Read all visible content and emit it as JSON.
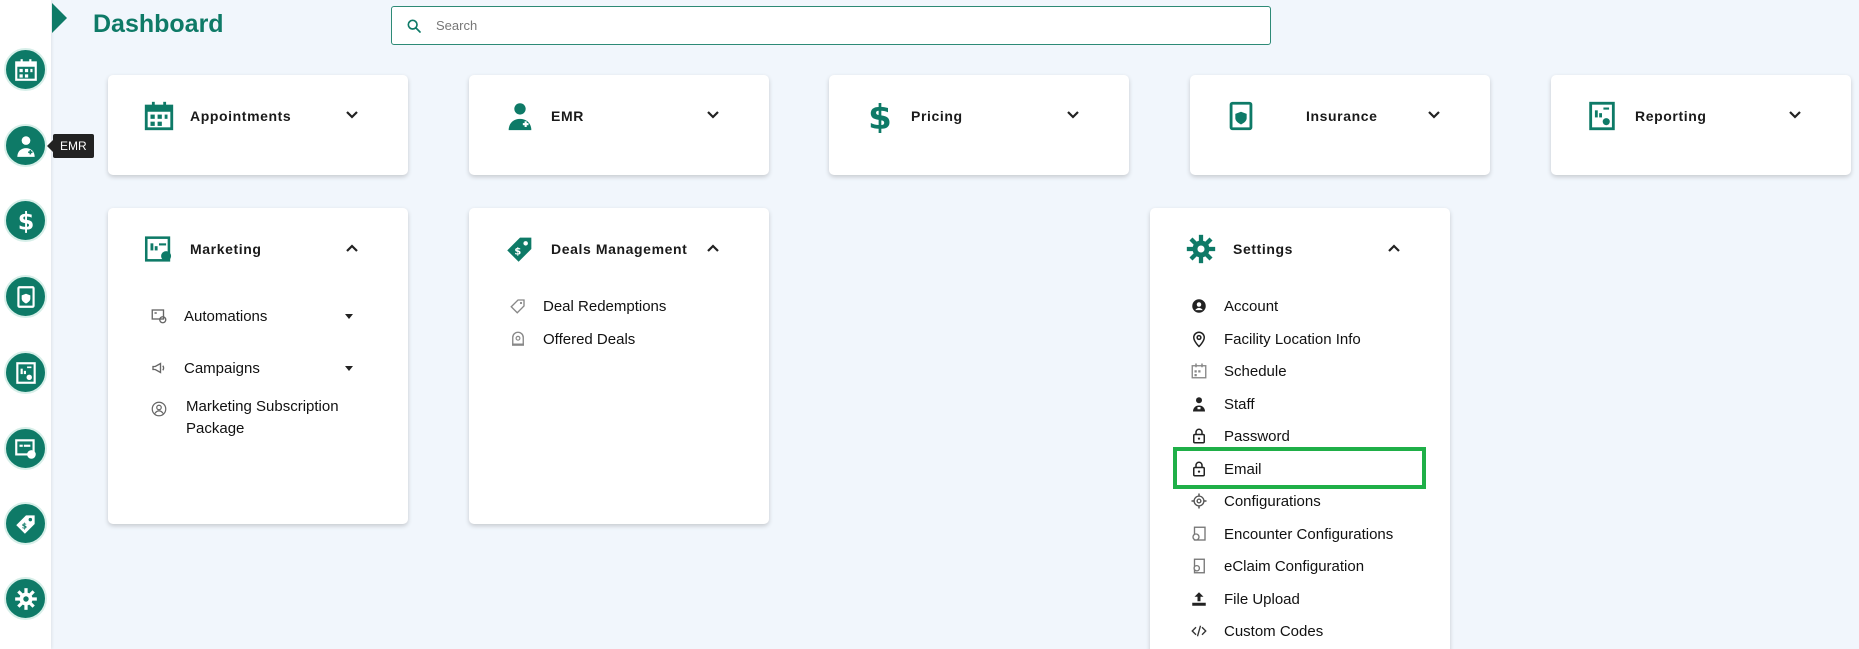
{
  "header": {
    "title": "Dashboard",
    "search_placeholder": "Search"
  },
  "tooltip": {
    "label": "EMR"
  },
  "rail": {
    "items": [
      "calendar-icon",
      "doctor-icon",
      "dollar-icon",
      "insurance-icon",
      "report-icon",
      "marketing-icon",
      "deal-tag-icon",
      "gear-icon"
    ]
  },
  "cards": {
    "appointments": {
      "label": "Appointments"
    },
    "emr": {
      "label": "EMR"
    },
    "pricing": {
      "label": "Pricing"
    },
    "insurance": {
      "label": "Insurance"
    },
    "reporting": {
      "label": "Reporting"
    },
    "marketing": {
      "label": "Marketing",
      "items": [
        {
          "label": "Automations",
          "icon": "automation-icon"
        },
        {
          "label": "Campaigns",
          "icon": "megaphone-icon"
        },
        {
          "label": "Marketing Subscription Package",
          "icon": "subscription-icon"
        }
      ]
    },
    "deals": {
      "label": "Deals Management",
      "items": [
        {
          "label": "Deal Redemptions",
          "icon": "tag-icon"
        },
        {
          "label": "Offered Deals",
          "icon": "offer-icon"
        }
      ]
    },
    "settings": {
      "label": "Settings",
      "items": [
        {
          "label": "Account",
          "icon": "account-icon"
        },
        {
          "label": "Facility Location Info",
          "icon": "location-pin-icon"
        },
        {
          "label": "Schedule",
          "icon": "schedule-icon"
        },
        {
          "label": "Staff",
          "icon": "staff-icon"
        },
        {
          "label": "Password",
          "icon": "lock-icon"
        },
        {
          "label": "Email",
          "icon": "lock-icon"
        },
        {
          "label": "Configurations",
          "icon": "gear-icon"
        },
        {
          "label": "Encounter Configurations",
          "icon": "encounter-config-icon"
        },
        {
          "label": "eClaim Configuration",
          "icon": "eclaim-icon"
        },
        {
          "label": "File Upload",
          "icon": "upload-icon"
        },
        {
          "label": "Custom Codes",
          "icon": "code-icon"
        }
      ]
    }
  },
  "colors": {
    "brand": "#0e7a67",
    "highlight": "#1faf48",
    "background": "#f1f6fc"
  }
}
